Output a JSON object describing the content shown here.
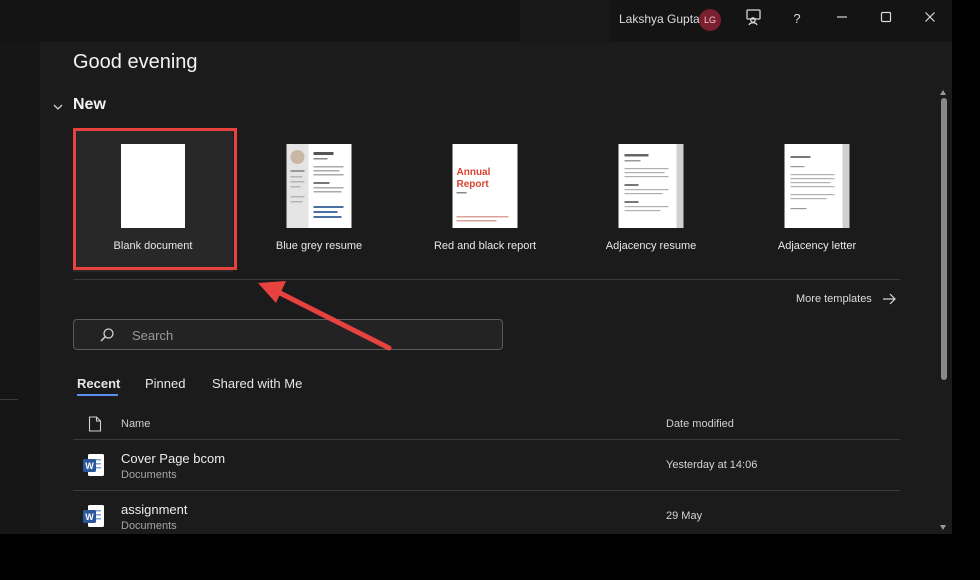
{
  "titlebar": {
    "user_name": "Lakshya Gupta",
    "avatar_initials": "LG",
    "help_label": "?"
  },
  "greeting": "Good evening",
  "new_section": {
    "label": "New",
    "templates": [
      {
        "name": "Blank document"
      },
      {
        "name": "Blue grey resume"
      },
      {
        "name": "Red and black report",
        "cover_text_1": "Annual",
        "cover_text_2": "Report"
      },
      {
        "name": "Adjacency resume"
      },
      {
        "name": "Adjacency letter"
      }
    ],
    "more_templates": "More templates"
  },
  "search": {
    "placeholder": "Search"
  },
  "tabs": [
    "Recent",
    "Pinned",
    "Shared with Me"
  ],
  "file_list": {
    "headers": {
      "name": "Name",
      "date": "Date modified"
    },
    "rows": [
      {
        "title": "Cover Page bcom",
        "location": "Documents",
        "date": "Yesterday at 14:06"
      },
      {
        "title": "assignment",
        "location": "Documents",
        "date": "29 May"
      }
    ]
  },
  "colors": {
    "accent_tab": "#5b8ef0",
    "annotation_red": "#e8423f",
    "word_blue": "#2b579a",
    "report_red": "#d9432f"
  }
}
